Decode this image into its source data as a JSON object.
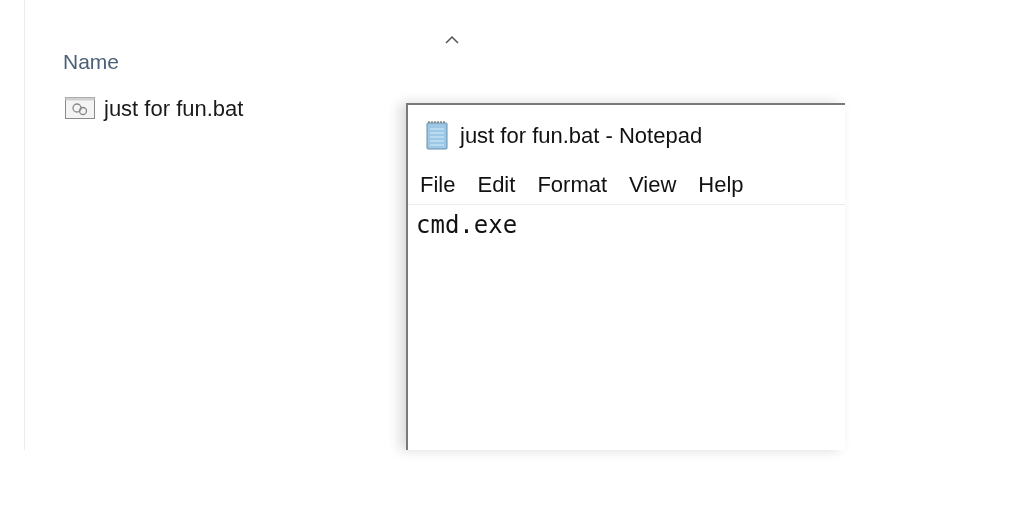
{
  "explorer": {
    "column_header": "Name",
    "files": [
      {
        "name": "just for fun.bat"
      }
    ]
  },
  "notepad": {
    "title": "just for fun.bat - Notepad",
    "menu": [
      "File",
      "Edit",
      "Format",
      "View",
      "Help"
    ],
    "content": "cmd.exe"
  }
}
